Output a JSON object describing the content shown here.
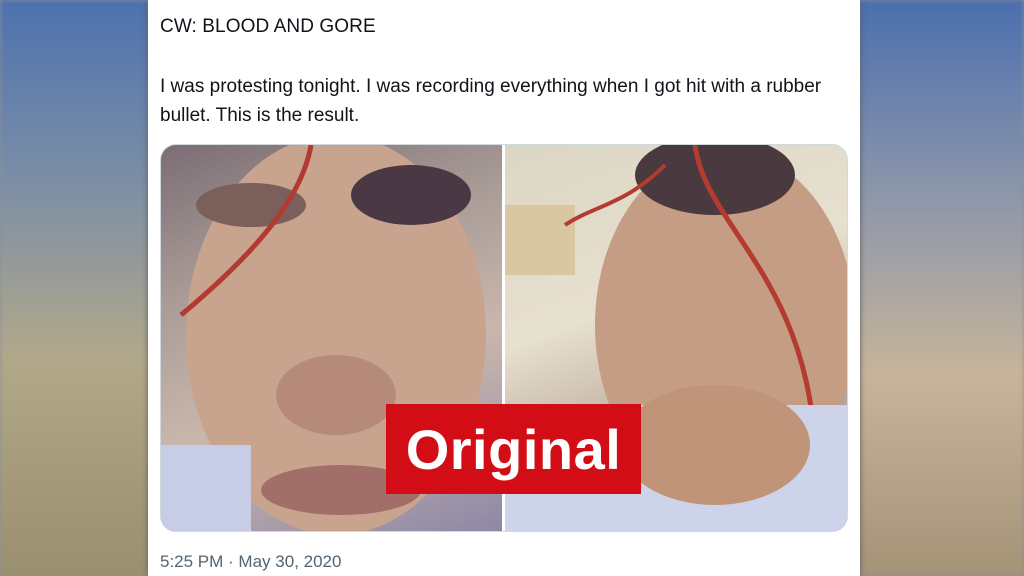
{
  "post": {
    "content_warning": "CW: BLOOD AND GORE",
    "text": "I was protesting tonight. I was recording everything when I got hit with a rubber bullet. This is the result.",
    "timestamp": "5:25 PM · May 30, 2020",
    "media": [
      {
        "name": "left-photo"
      },
      {
        "name": "right-photo"
      }
    ]
  },
  "overlay": {
    "label": "Original",
    "color": "#d30d16"
  }
}
